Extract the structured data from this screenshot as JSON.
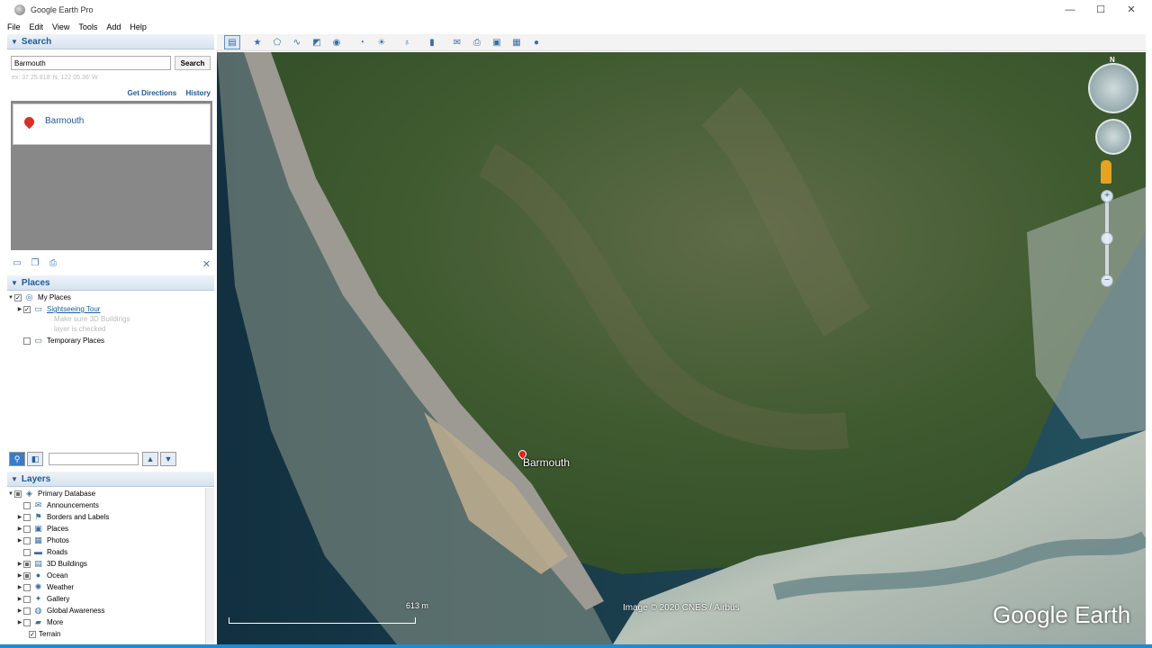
{
  "window": {
    "title": "Google Earth Pro",
    "minimize": "—",
    "maximize": "☐",
    "close": "✕"
  },
  "menu": [
    "File",
    "Edit",
    "View",
    "Tools",
    "Add",
    "Help"
  ],
  "search": {
    "header": "Search",
    "query": "Barmouth",
    "button": "Search",
    "hint": "ex: 37 25.818' N, 122 05.36' W",
    "get_directions": "Get Directions",
    "history": "History",
    "result": "Barmouth"
  },
  "places": {
    "header": "Places",
    "my_places": "My Places",
    "sightseeing": "Sightseeing Tour",
    "note1": "Make sure 3D Buildings",
    "note2": "layer is checked",
    "temporary": "Temporary Places"
  },
  "layers": {
    "header": "Layers",
    "items": [
      {
        "label": "Primary Database",
        "icon": "◈"
      },
      {
        "label": "Announcements",
        "icon": "✉"
      },
      {
        "label": "Borders and Labels",
        "icon": "⚑"
      },
      {
        "label": "Places",
        "icon": "▣"
      },
      {
        "label": "Photos",
        "icon": "▦"
      },
      {
        "label": "Roads",
        "icon": "▬"
      },
      {
        "label": "3D Buildings",
        "icon": "▤"
      },
      {
        "label": "Ocean",
        "icon": "●"
      },
      {
        "label": "Weather",
        "icon": "✺"
      },
      {
        "label": "Gallery",
        "icon": "✦"
      },
      {
        "label": "Global Awareness",
        "icon": "◍"
      },
      {
        "label": "More",
        "icon": "▰"
      },
      {
        "label": "Terrain",
        "icon": ""
      }
    ]
  },
  "map": {
    "place_label": "Barmouth",
    "scale_text": "613 m",
    "credit": "Image © 2020 CNES / Airbus",
    "brand": "Google Earth",
    "north": "N",
    "zoom_in": "+",
    "zoom_out": "−"
  },
  "colors": {
    "accent": "#1d5a9b",
    "pin": "#e2211c",
    "taskbar": "#1f8bd4"
  }
}
